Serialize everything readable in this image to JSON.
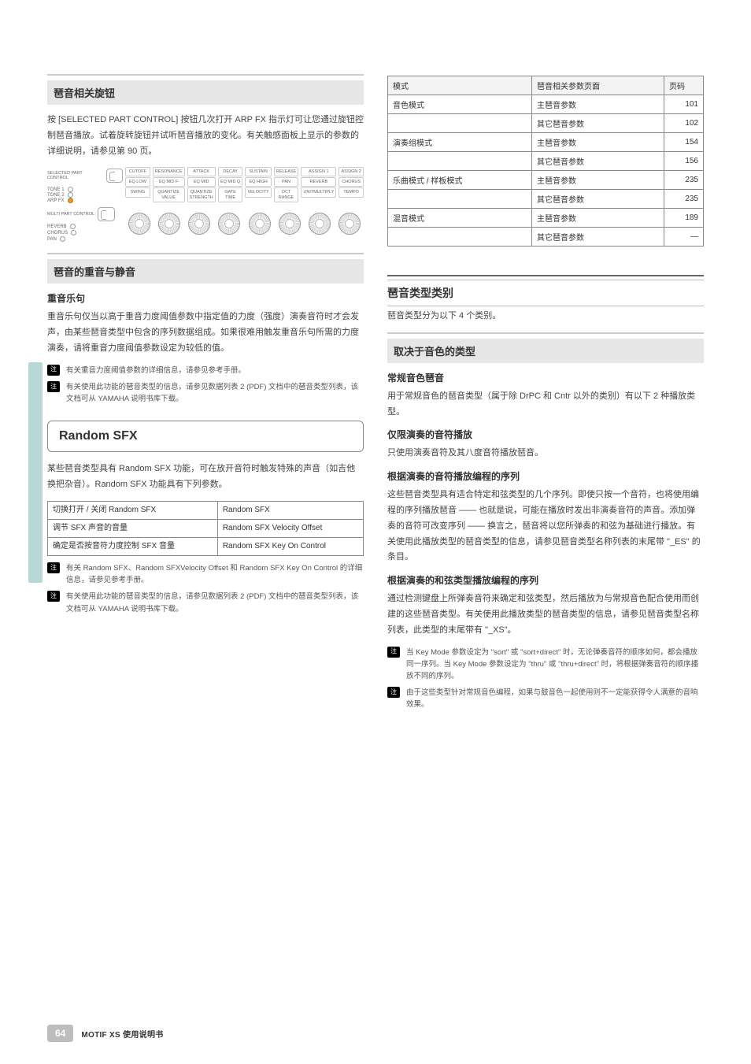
{
  "left": {
    "section_title_1": "琶音相关旋钮",
    "para_1": "按 [SELECTED PART CONTROL] 按钮几次打开 ARP FX 指示灯可让您通过旋钮控制琶音播放。试着旋转旋钮并试听琶音播放的变化。有关触感面板上显示的参数的详细说明，请参见第 90 页。",
    "knob_panel": {
      "left_rows": [
        {
          "led": false,
          "label": "TONE 1"
        },
        {
          "led": false,
          "label": "TONE 2"
        },
        {
          "led": true,
          "label": "ARP FX"
        }
      ],
      "grid": [
        [
          "CUTOFF",
          "RESONANCE",
          "ATTACK",
          "DECAY",
          "SUSTAIN",
          "RELEASE",
          "ASSIGN 1",
          "ASSIGN 2"
        ],
        [
          "EQ LOW",
          "EQ MID F",
          "EQ MID",
          "EQ MID Q",
          "EQ HIGH",
          "PAN",
          "REVERB",
          "CHORUS"
        ],
        [
          "SWING",
          "QUANTIZE VALUE",
          "QUANTIZE STRENGTH",
          "GATE TIME",
          "VELOCITY",
          "OCT RANGE",
          "UNITMULTIPLY",
          "TEMPO"
        ]
      ],
      "selected_part": "SELECTED PART CONTROL",
      "multi_part_rows": [
        {
          "led": false,
          "label": "REVERB"
        },
        {
          "led": false,
          "label": "CHORUS"
        },
        {
          "led": false,
          "label": "PAN"
        }
      ],
      "multi_part": "MULTI PART CONTROL"
    },
    "section_title_2": "琶音的重音与静音",
    "subsection_2a": "重音乐句",
    "para_2a": "重音乐句仅当以高于重音力度阈值参数中指定值的力度（强度）演奏音符时才会发声，由某些琶音类型中包含的序列数据组成。如果很难用触发重音乐句所需的力度演奏，请将重音力度阈值参数设定为较低的值。",
    "note_2a_1": "有关重音力度阈值参数的详细信息，请参见参考手册。",
    "note_2a_2": "有关使用此功能的琶音类型的信息，请参见数据列表 2 (PDF) 文档中的琶音类型列表，该文档可从 YAMAHA 说明书库下载。",
    "random_sfx_title": "Random SFX",
    "para_random": "某些琶音类型具有 Random SFX 功能，可在放开音符时触发特殊的声音（如吉他换把杂音）。Random SFX 功能具有下列参数。",
    "sfx_table": {
      "rows": [
        {
          "l": "切换打开 / 关闭 Random SFX",
          "r": "Random SFX"
        },
        {
          "l": "调节 SFX 声音的音量",
          "r": "Random SFX Velocity Offset"
        },
        {
          "l": "确定是否按音符力度控制 SFX 音量",
          "r": "Random SFX Key On Control"
        }
      ]
    },
    "note_r_1": "有关 Random SFX、Random SFXVelocity Offset 和 Random SFX Key On Control 的详细信息，请参见参考手册。",
    "note_r_2": "有关使用此功能的琶音类型的信息，请参见数据列表 2 (PDF) 文档中的琶音类型列表，该文档可从 YAMAHA 说明书库下载。"
  },
  "right": {
    "modes_table": {
      "header": [
        "模式",
        "琶音相关参数页面",
        "页码"
      ],
      "rows": [
        {
          "a": "音色模式",
          "b": "主琶音参数",
          "c": "101"
        },
        {
          "a": "",
          "b": "其它琶音参数",
          "c": "102"
        },
        {
          "a": "演奏组模式",
          "b": "主琶音参数",
          "c": "154"
        },
        {
          "a": "",
          "b": "其它琶音参数",
          "c": "156"
        },
        {
          "a": "乐曲模式 / 样板模式",
          "b": "主琶音参数",
          "c": "235"
        },
        {
          "a": "",
          "b": "其它琶音参数",
          "c": "235"
        },
        {
          "a": "混音模式",
          "b": "主琶音参数",
          "c": "189"
        },
        {
          "a": "",
          "b": "其它琶音参数",
          "c": "—"
        }
      ]
    },
    "cat_heading": "琶音类型类别",
    "cat_para": "琶音类型分为以下 4 个类别。",
    "cat_section": "取决于音色的类型",
    "sub1_title": "常规音色琶音",
    "sub1_text": "用于常规音色的琶音类型（属于除 DrPC 和 Cntr 以外的类别）有以下 2 种播放类型。",
    "sub2_title": "仅限演奏的音符播放",
    "sub2_text": "只使用演奏音符及其八度音符播放琶音。",
    "sub3_title": "根据演奏的音符播放编程的序列",
    "sub3_text": "这些琶音类型具有适合特定和弦类型的几个序列。即使只按一个音符，也将使用编程的序列播放琶音 —— 也就是说，可能在播放时发出非演奏音符的声音。添加弹奏的音符可改变序列 —— 换言之，琶音将以您所弹奏的和弦为基础进行播放。有关使用此播放类型的琶音类型的信息，请参见琶音类型名称列表的末尾带 \"_ES\" 的条目。",
    "sub4_title": "根据演奏的和弦类型播放编程的序列",
    "sub4_text": "通过检测键盘上所弹奏音符来确定和弦类型，然后播放为与常规音色配合使用而创建的这些琶音类型。有关使用此播放类型的琶音类型的信息，请参见琶音类型名称列表，此类型的末尾带有 \"_XS\"。",
    "note_r1": "当 Key Mode 参数设定为 \"sort\" 或 \"sort+direct\" 时，无论弹奏音符的顺序如何，都会播放同一序列。当 Key Mode 参数设定为 \"thru\" 或 \"thru+direct\" 时，将根据弹奏音符的顺序播放不同的序列。",
    "note_r2": "由于这些类型针对常规音色编程，如果与鼓音色一起使用则不一定能获得令人满意的音响效果。"
  },
  "footer": {
    "page": "64",
    "title": "MOTIF XS 使用说明书"
  },
  "note_label": "注"
}
